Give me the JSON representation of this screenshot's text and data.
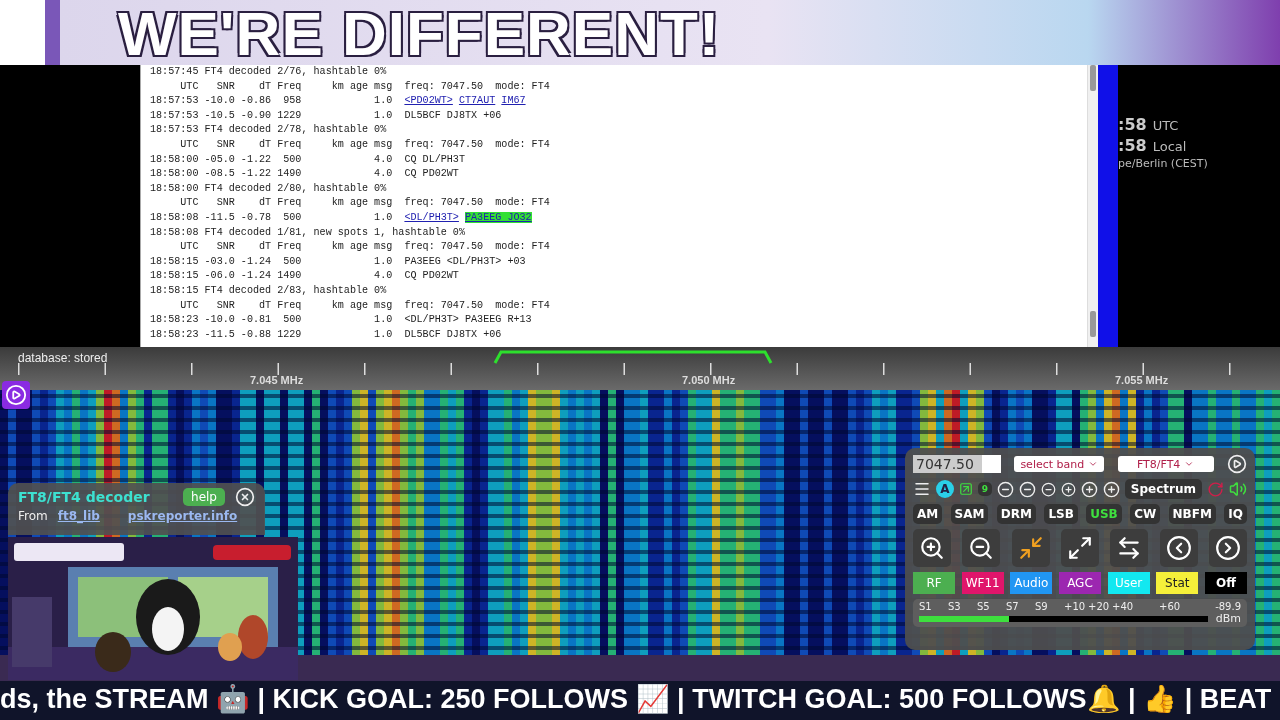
{
  "banner": {
    "title": "WE'RE DIFFERENT!"
  },
  "log": {
    "lines": [
      {
        "text": "18:57:45 FT4 decoded 2/76, hashtable 0%"
      },
      {
        "text": "     UTC   SNR    dT Freq     km age msg  freq: 7047.50  mode: FT4"
      },
      {
        "text": "18:57:53 -10.0 -0.86  958            1.0  ",
        "links": [
          {
            "text": "<PD02WT>",
            "highlighted": false
          },
          {
            "text": "CT7AUT",
            "highlighted": false
          },
          {
            "text": "IM67",
            "highlighted": false
          }
        ]
      },
      {
        "text": "18:57:53 -10.5 -0.90 1229            1.0  DL5BCF DJ8TX +06"
      },
      {
        "text": "18:57:53 FT4 decoded 2/78, hashtable 0%"
      },
      {
        "text": "     UTC   SNR    dT Freq     km age msg  freq: 7047.50  mode: FT4"
      },
      {
        "text": "18:58:00 -05.0 -1.22  500            4.0  CQ DL/PH3T"
      },
      {
        "text": "18:58:00 -08.5 -1.22 1490            4.0  CQ PD02WT"
      },
      {
        "text": "18:58:00 FT4 decoded 2/80, hashtable 0%"
      },
      {
        "text": "     UTC   SNR    dT Freq     km age msg  freq: 7047.50  mode: FT4"
      },
      {
        "text": "18:58:08 -11.5 -0.78  500            1.0  ",
        "links": [
          {
            "text": "<DL/PH3T>",
            "highlighted": false
          },
          {
            "text": "PA3EEG JO32",
            "highlighted": true
          }
        ]
      },
      {
        "text": "18:58:08 FT4 decoded 1/81, new spots 1, hashtable 0%"
      },
      {
        "text": "     UTC   SNR    dT Freq     km age msg  freq: 7047.50  mode: FT4"
      },
      {
        "text": "18:58:15 -03.0 -1.24  500            1.0  PA3EEG <DL/PH3T> +03"
      },
      {
        "text": "18:58:15 -06.0 -1.24 1490            4.0  CQ PD02WT"
      },
      {
        "text": "18:58:15 FT4 decoded 2/83, hashtable 0%"
      },
      {
        "text": "     UTC   SNR    dT Freq     km age msg  freq: 7047.50  mode: FT4"
      },
      {
        "text": "18:58:23 -10.0 -0.81  500            1.0  <DL/PH3T> PA3EEG R+13"
      },
      {
        "text": "18:58:23 -11.5 -0.88 1229            1.0  DL5BCF DJ8TX +06"
      }
    ]
  },
  "clock": {
    "utc_time": ":58",
    "utc_label": "UTC",
    "local_time": ":58",
    "local_label": "Local",
    "timezone": "pe/Berlin (CEST)"
  },
  "scale": {
    "status": "database: stored",
    "labels": [
      "7.045 MHz",
      "7.050 MHz",
      "7.055 MHz"
    ]
  },
  "decoder": {
    "title": "FT8/FT4 decoder",
    "help": "help",
    "from": "From",
    "links": [
      "ft8_lib",
      "pskreporter.info"
    ]
  },
  "controls": {
    "frequency": "7047.50",
    "band_select": "select band",
    "mode_select": "FT8/FT4",
    "agc_badge": "A",
    "count_badge": "9",
    "spectrum": "Spectrum",
    "modes": [
      {
        "label": "AM",
        "selected": false
      },
      {
        "label": "SAM",
        "selected": false
      },
      {
        "label": "DRM",
        "selected": false
      },
      {
        "label": "LSB",
        "selected": false
      },
      {
        "label": "USB",
        "selected": true
      },
      {
        "label": "CW",
        "selected": false
      },
      {
        "label": "NBFM",
        "selected": false
      },
      {
        "label": "IQ",
        "selected": false
      }
    ],
    "tabs": [
      {
        "label": "RF",
        "color": "#4caf50"
      },
      {
        "label": "WF11",
        "color": "#e0156b"
      },
      {
        "label": "Audio",
        "color": "#2196f3"
      },
      {
        "label": "AGC",
        "color": "#9c27b0"
      },
      {
        "label": "User",
        "color": "#12e8f0"
      },
      {
        "label": "Stat",
        "color": "#f5f03a"
      },
      {
        "label": "Off",
        "color": "#000000"
      }
    ],
    "smeter": {
      "scale": [
        "S1",
        "S3",
        "S5",
        "S7",
        "S9",
        "+10",
        "+20",
        "+40",
        "+60"
      ],
      "reading": "-89.9",
      "unit": "dBm",
      "level": 0.31
    }
  },
  "ticker": {
    "text": "ds, the STREAM 🤖 | KICK GOAL: 250 FOLLOWS 📈 | TWITCH GOAL: 500 FOLLOWS🔔 | 👍 | BEAT"
  }
}
